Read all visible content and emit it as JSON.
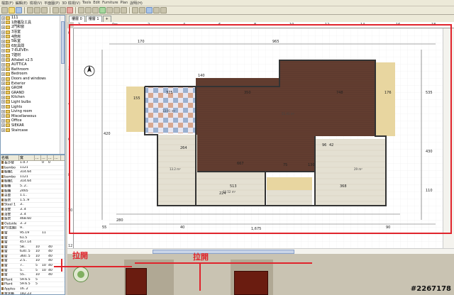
{
  "menubar": {
    "items": [
      "檔案(F)",
      "編輯(E)",
      "檢視(V)",
      "平面圖(P)",
      "3D 檢視(V)",
      "Tools",
      "Edit",
      "Furniture",
      "Plan",
      "說明(H)"
    ]
  },
  "tree": {
    "items": [
      "111",
      "1廚櫃及工具",
      "2門和窗",
      "3浴室",
      "4廚房",
      "5臥室",
      "6玩具間",
      "7-ELEVEn",
      "7建材",
      "Alfabet v2.5",
      "AUTTICA",
      "Bathroom",
      "Bedroom",
      "Doors and windows",
      "Exterior",
      "GROM",
      "GRAND",
      "Kitchen",
      "Light bulbs",
      "Lights",
      "Living room",
      "Miscellaneous",
      "Office",
      "SIEKAR",
      "Staircase"
    ]
  },
  "furniture_table": {
    "headers": [
      "名稱",
      "寬",
      "...",
      "...",
      "...",
      "..."
    ],
    "rows": [
      [
        "長沙發",
        "1.0.7",
        "",
        "0",
        "0",
        ""
      ],
      [
        "bambo",
        "1121",
        "",
        "",
        "",
        ""
      ],
      [
        "櫥櫃1",
        "314.64",
        "",
        "",
        "",
        ""
      ],
      [
        "bambo",
        "1121",
        "",
        "",
        "",
        ""
      ],
      [
        "櫥櫃1",
        "314.64",
        "",
        "",
        "",
        ""
      ],
      [
        "櫥櫃",
        "5..2..",
        "",
        "",
        "",
        ""
      ],
      [
        "櫥櫃",
        "2465",
        "",
        "",
        "",
        ""
      ],
      [
        "菜單",
        "1.1..",
        "",
        "",
        "",
        ""
      ],
      [
        "廚房",
        "1.5..9",
        "",
        "",
        "",
        ""
      ],
      [
        "Steel 1",
        "3..",
        "",
        "",
        "",
        ""
      ],
      [
        "浴室",
        "3..4",
        "",
        "",
        "",
        ""
      ],
      [
        "浴室",
        "3..4",
        "",
        "",
        "",
        ""
      ],
      [
        "廚房",
        "468.60",
        "",
        "",
        "",
        ""
      ],
      [
        "Outside",
        "3..3",
        "",
        "",
        "",
        ""
      ],
      [
        "門(玄關)",
        "9..",
        "",
        "",
        "",
        ""
      ],
      [
        "窗",
        "95.19",
        "",
        "11",
        "",
        ""
      ],
      [
        "窗",
        "61.5",
        "",
        "",
        "",
        ""
      ],
      [
        "窗",
        "457.14",
        "",
        "",
        "",
        ""
      ],
      [
        "窗",
        "58..",
        "10",
        "",
        "40",
        ""
      ],
      [
        "窗",
        "630..5",
        "10",
        "",
        "40",
        ""
      ],
      [
        "窗",
        "360..5",
        "10",
        "",
        "40",
        ""
      ],
      [
        "窗",
        "2.5..",
        "10",
        "",
        "40",
        ""
      ],
      [
        "窗",
        "7..",
        "5",
        "10",
        "40",
        ""
      ],
      [
        "窗",
        "5..",
        "5",
        "10",
        "40",
        ""
      ],
      [
        "窗",
        "55..",
        "10",
        "",
        "40",
        ""
      ],
      [
        "Plant",
        "59.6.5",
        "5",
        "",
        "",
        ""
      ],
      [
        "Plant",
        "59.6.5",
        "5",
        "",
        "",
        ""
      ],
      [
        "Apples",
        "16..2",
        "",
        "",
        "",
        ""
      ],
      [
        "電冰箱",
        "182.23",
        "",
        "",
        "",
        ""
      ],
      [
        "一門",
        "16..14",
        "",
        "",
        "",
        ""
      ],
      [
        "Vase",
        "3..2",
        "",
        "",
        "",
        ""
      ]
    ]
  },
  "tabs": [
    "樓層 0",
    "樓層 1",
    "+"
  ],
  "ruler": {
    "top": [
      "-2",
      "0m",
      "2",
      "4",
      "6",
      "8",
      "10",
      "12",
      "14",
      "16",
      "18"
    ],
    "left": [
      "0",
      "2",
      "4",
      "6",
      "8",
      "10",
      "12"
    ]
  },
  "plan": {
    "dims": [
      "170",
      "965",
      "535",
      "140",
      "420",
      "350",
      "748",
      "176",
      "375",
      "264",
      "155",
      "667",
      "75",
      "130",
      "96",
      "42",
      "513",
      "224",
      "368",
      "280",
      "55",
      "1,675",
      "90",
      "110",
      "430",
      "40"
    ],
    "areas": [
      "13.91 m²",
      "51.41 m²",
      "13.2 m²",
      "12.52 m²",
      "29 m²"
    ]
  },
  "annotations": {
    "pull1": "拉開",
    "pull2": "拉開"
  },
  "watermark": "#2267178",
  "colors": {
    "accent_red": "#e0242c",
    "wood": "#5e3a2e",
    "tile": "#e8e0c8"
  }
}
